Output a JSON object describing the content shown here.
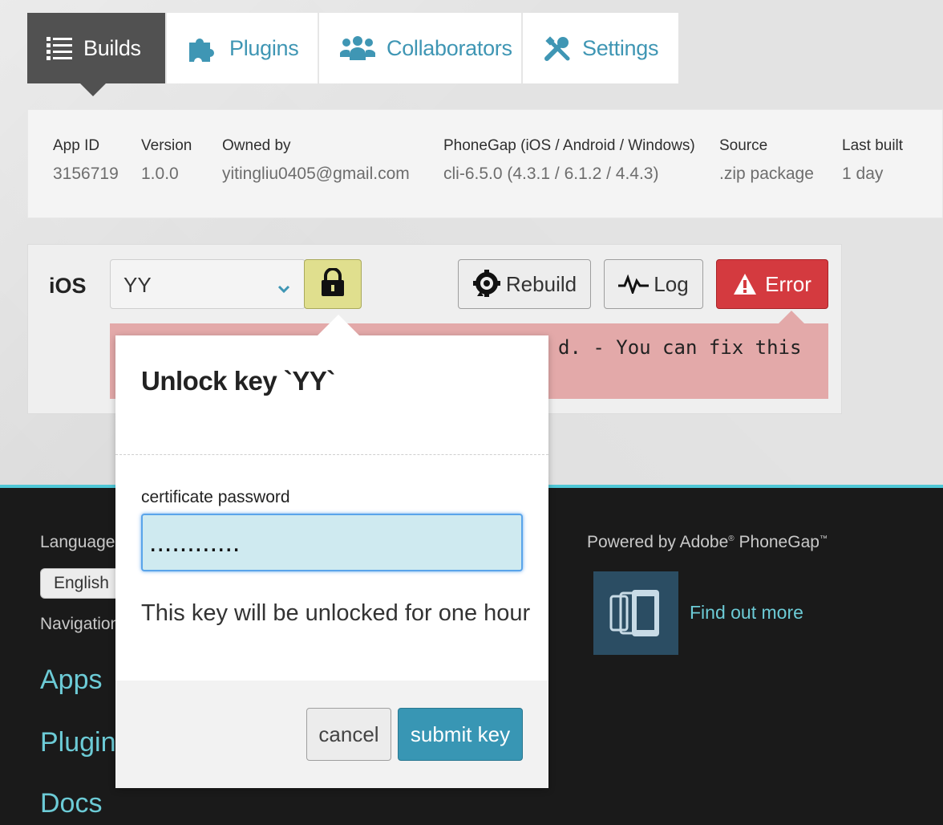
{
  "tabs": [
    {
      "label": "Builds",
      "icon": "list-icon"
    },
    {
      "label": "Plugins",
      "icon": "puzzle-icon"
    },
    {
      "label": "Collaborators",
      "icon": "people-icon"
    },
    {
      "label": "Settings",
      "icon": "wrench-icon"
    }
  ],
  "info": {
    "app_id_label": "App ID",
    "app_id": "3156719",
    "version_label": "Version",
    "version": "1.0.0",
    "owner_label": "Owned by",
    "owner": "yitingliu0405@gmail.com",
    "phonegap_label": "PhoneGap (iOS / Android / Windows)",
    "phonegap": "cli-6.5.0 (4.3.1 / 6.1.2 / 4.4.3)",
    "source_label": "Source",
    "source": ".zip package",
    "last_built_label": "Last built",
    "last_built": "1 day"
  },
  "build": {
    "platform": "iOS",
    "key_selected": "YY",
    "rebuild_label": "Rebuild",
    "log_label": "Log",
    "error_label": "Error",
    "error_text": "d. - You can fix this"
  },
  "popover": {
    "title": "Unlock key `YY`",
    "field_label": "certificate password",
    "password_value": "............",
    "note": "This key will be unlocked for one hour",
    "cancel_label": "cancel",
    "submit_label": "submit key"
  },
  "footer": {
    "language_label": "Language:",
    "language_value": "English",
    "navigation_label": "Navigation",
    "links": [
      "Apps",
      "Plugins",
      "Docs"
    ],
    "powered_by": "Powered by Adobe",
    "powered_brand": "PhoneGap",
    "find_out_more": "Find out more"
  },
  "colors": {
    "accent": "#3f96b4",
    "active_tab": "#515151",
    "error": "#d43a3f",
    "lock": "#e0df8e",
    "footer_bg": "#1a1a1a",
    "footer_link": "#6ccbd6"
  }
}
